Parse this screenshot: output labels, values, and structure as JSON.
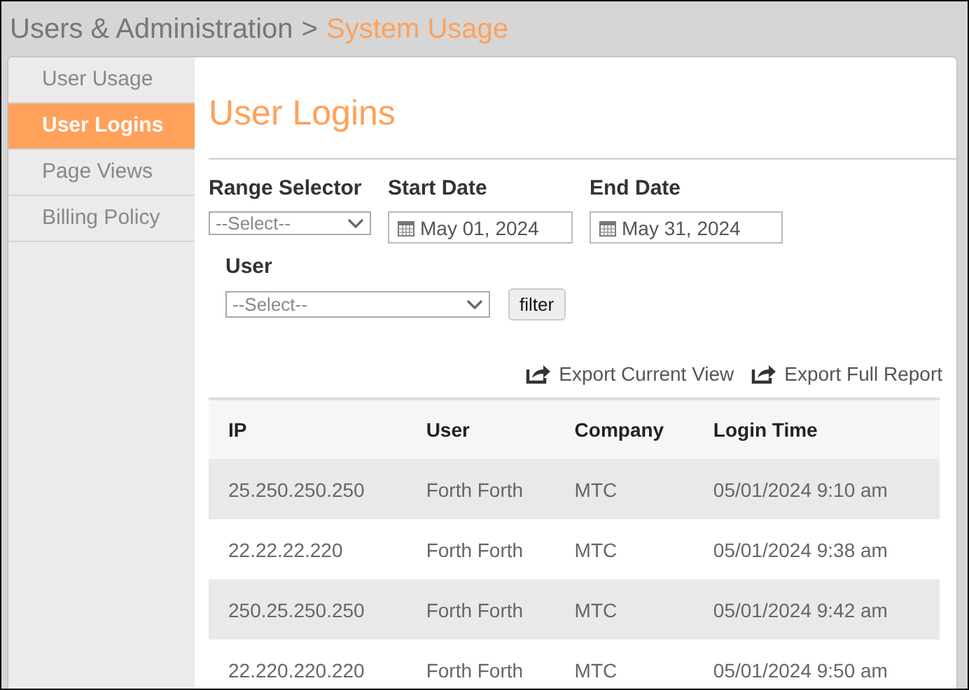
{
  "breadcrumb": {
    "parent": "Users & Administration",
    "separator": ">",
    "current": "System Usage"
  },
  "sidebar": {
    "items": [
      {
        "label": "User Usage",
        "selected": false
      },
      {
        "label": "User Logins",
        "selected": true
      },
      {
        "label": "Page Views",
        "selected": false
      },
      {
        "label": "Billing Policy",
        "selected": false
      }
    ]
  },
  "page_title": "User Logins",
  "filters": {
    "range_selector": {
      "label": "Range Selector",
      "value": "--Select--"
    },
    "start_date": {
      "label": "Start Date",
      "value": "May 01, 2024"
    },
    "end_date": {
      "label": "End Date",
      "value": "May 31, 2024"
    },
    "user": {
      "label": "User",
      "value": "--Select--"
    },
    "button": "filter"
  },
  "exports": [
    "Export Current View",
    "Export Full Report"
  ],
  "table": {
    "columns": [
      "IP",
      "User",
      "Company",
      "Login Time"
    ],
    "rows": [
      [
        "25.250.250.250",
        "Forth Forth",
        "MTC",
        "05/01/2024 9:10 am"
      ],
      [
        "22.22.22.220",
        "Forth Forth",
        "MTC",
        "05/01/2024 9:38 am"
      ],
      [
        "250.25.250.250",
        "Forth Forth",
        "MTC",
        "05/01/2024 9:42 am"
      ],
      [
        "22.220.220.220",
        "Forth Forth",
        "MTC",
        "05/01/2024 9:50 am"
      ]
    ]
  }
}
